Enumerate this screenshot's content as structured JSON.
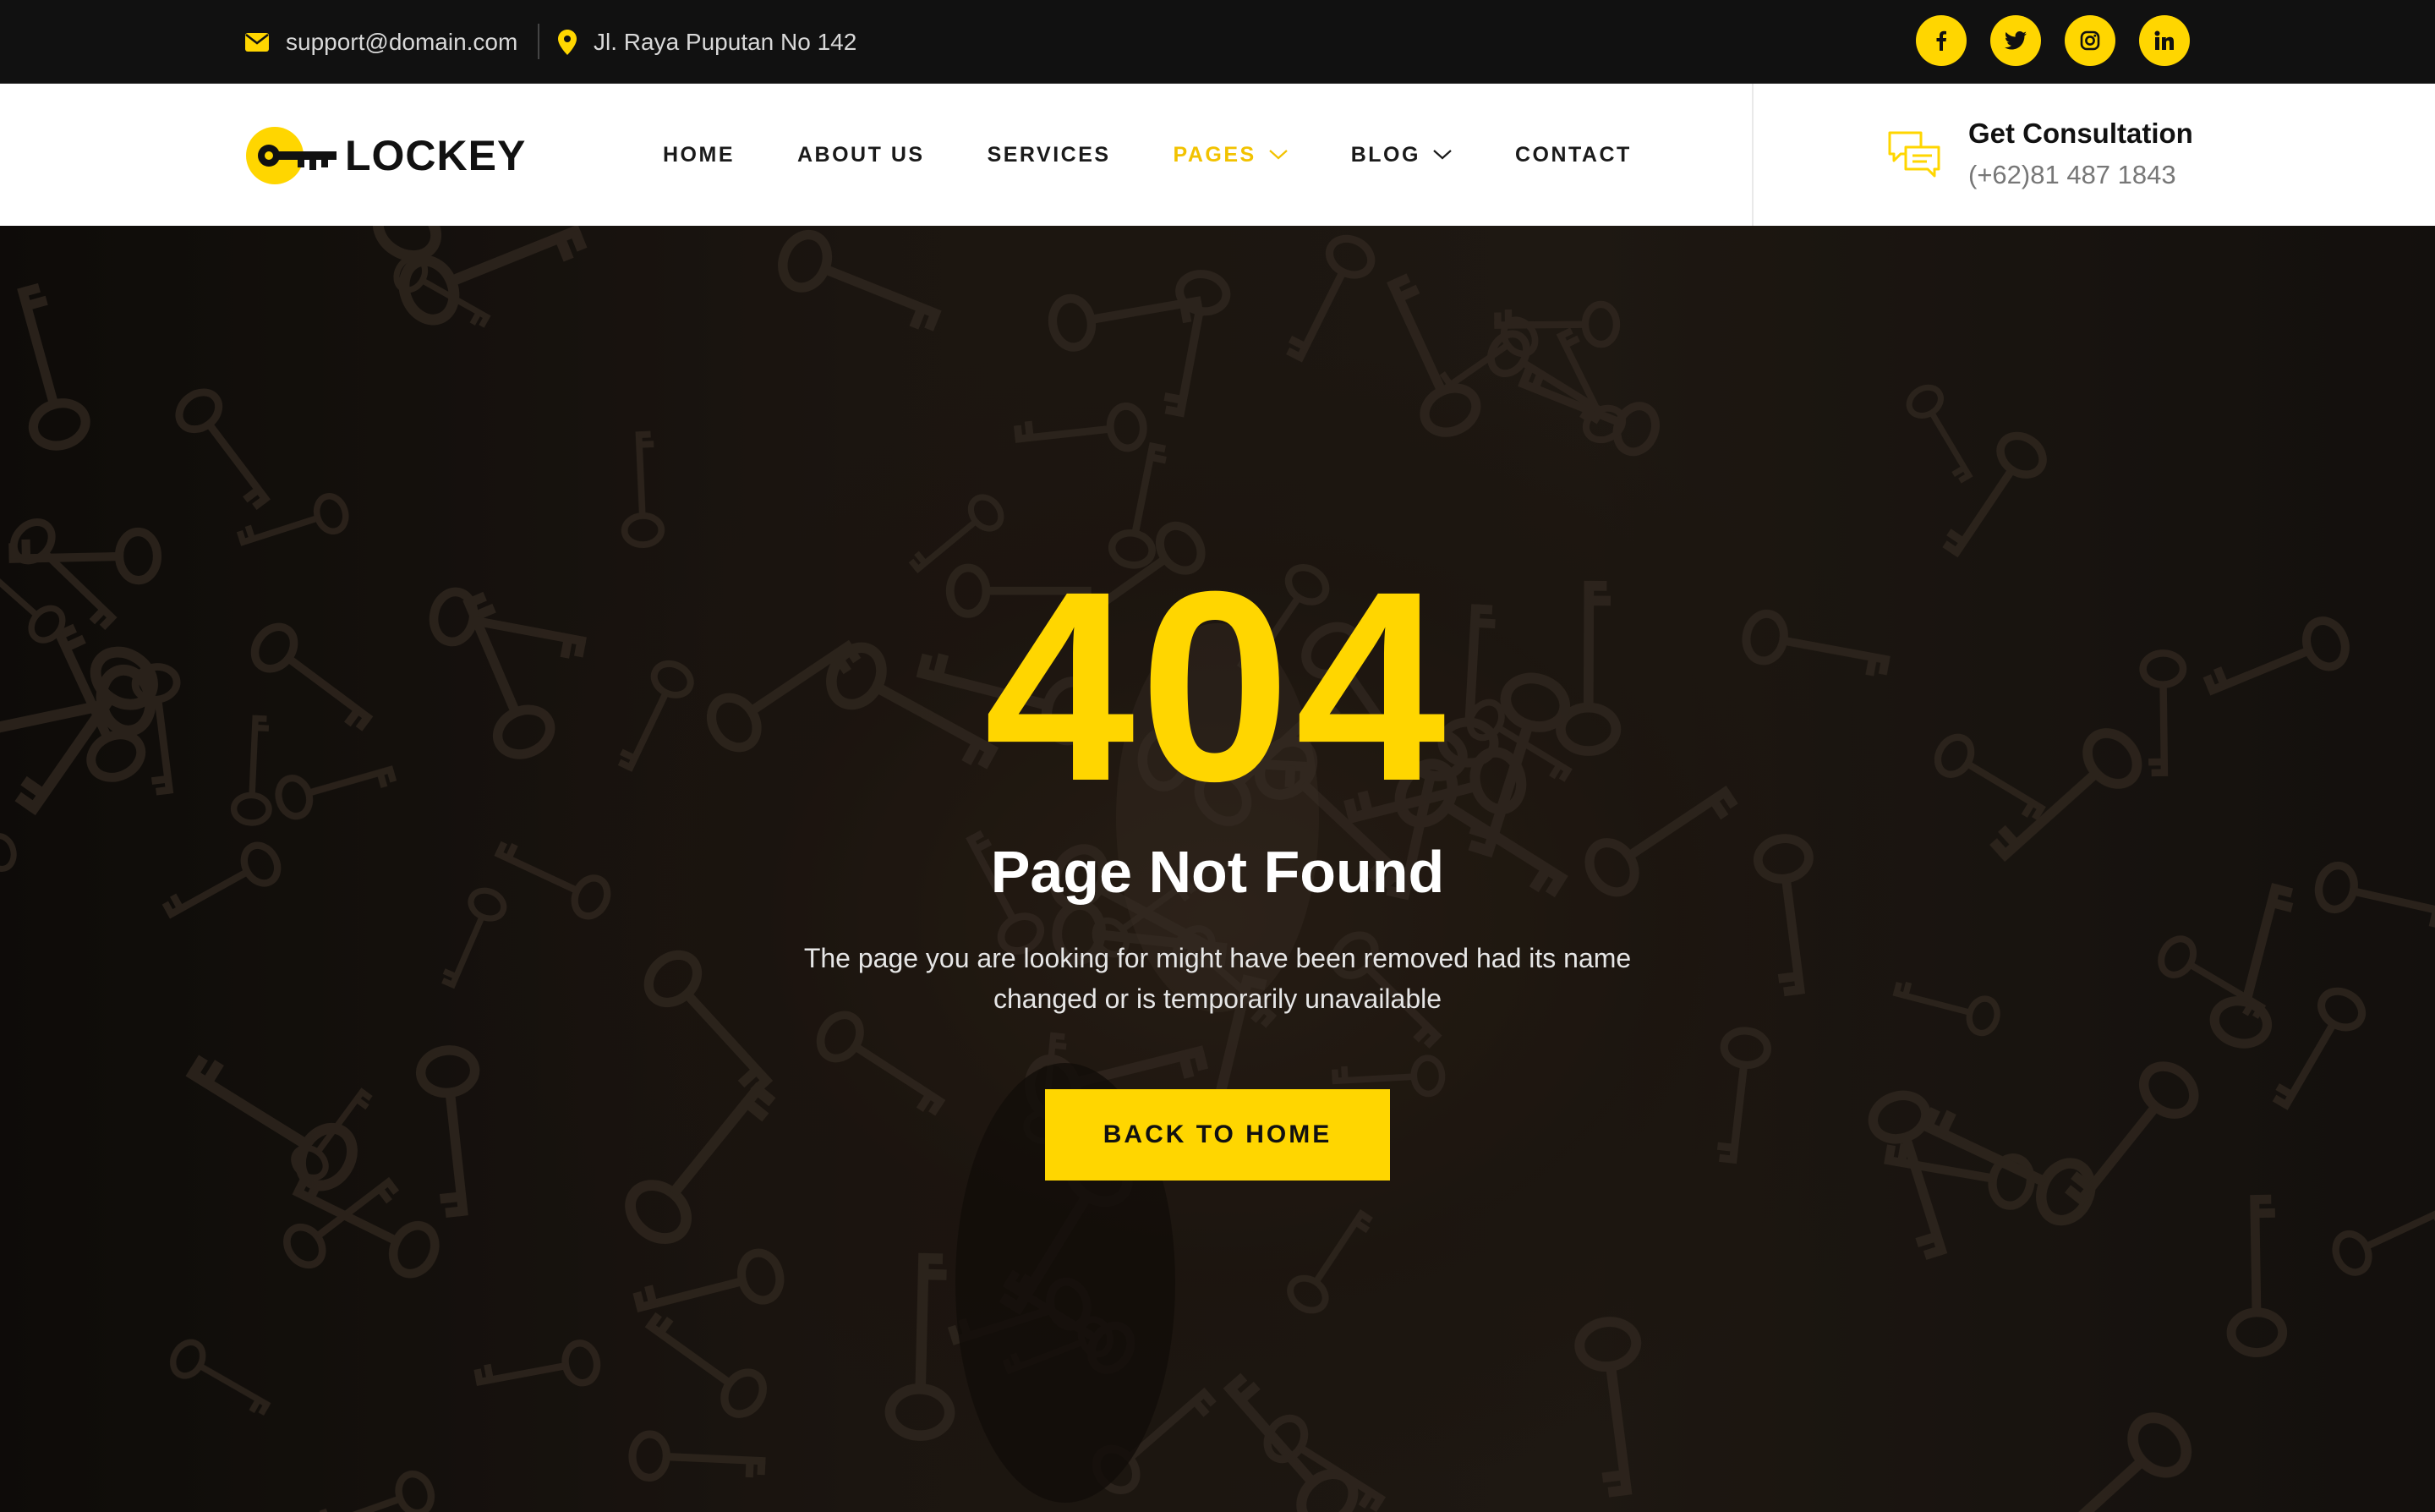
{
  "topbar": {
    "email": "support@domain.com",
    "address": "Jl. Raya Puputan No 142",
    "socials": [
      "facebook-icon",
      "twitter-icon",
      "instagram-icon",
      "linkedin-icon"
    ]
  },
  "header": {
    "logo_text": "LOCKEY",
    "nav": [
      {
        "label": "HOME"
      },
      {
        "label": "ABOUT US"
      },
      {
        "label": "SERVICES"
      },
      {
        "label": "PAGES",
        "active": true,
        "dropdown": true
      },
      {
        "label": "BLOG",
        "dropdown": true
      },
      {
        "label": "CONTACT"
      }
    ],
    "consult_title": "Get Consultation",
    "consult_phone": "(+62)81 487 1843"
  },
  "hero": {
    "code": "404",
    "title": "Page Not Found",
    "description": "The page you are looking for might have been removed had its name changed or is temporarily unavailable",
    "button_label": "BACK TO HOME"
  },
  "colors": {
    "accent": "#FFD600",
    "topbar_bg": "#111111",
    "header_bg": "#FFFFFF"
  }
}
